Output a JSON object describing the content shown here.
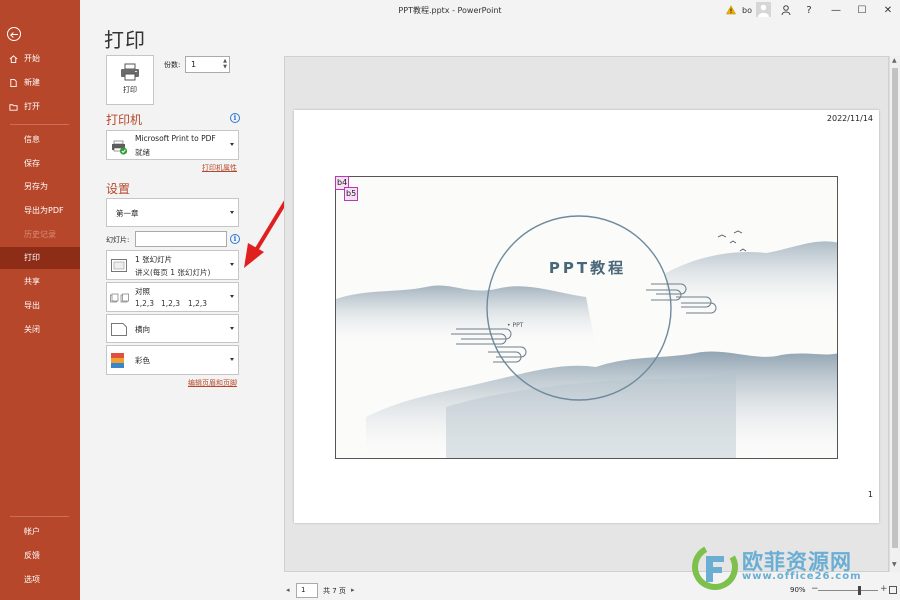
{
  "window": {
    "title": "PPT教程.pptx  -  PowerPoint",
    "user": "bo",
    "help_label": "?",
    "minimize_glyph": "—",
    "maximize_glyph": "☐",
    "close_glyph": "✕"
  },
  "nav": {
    "items": [
      {
        "label": "开始",
        "icon": "home-icon"
      },
      {
        "label": "新建",
        "icon": "new-doc-icon"
      },
      {
        "label": "打开",
        "icon": "folder-icon"
      },
      {
        "label": "信息"
      },
      {
        "label": "保存"
      },
      {
        "label": "另存为"
      },
      {
        "label": "导出为PDF"
      },
      {
        "label": "历史记录"
      },
      {
        "label": "打印"
      },
      {
        "label": "共享"
      },
      {
        "label": "导出"
      },
      {
        "label": "关闭"
      },
      {
        "label": "帐户"
      },
      {
        "label": "反馈"
      },
      {
        "label": "选项"
      }
    ],
    "active": "打印",
    "disabled": "历史记录"
  },
  "print": {
    "page_title": "打印",
    "print_button_label": "打印",
    "copies_label": "份数:",
    "copies_value": "1",
    "printer_heading": "打印机",
    "printer_name": "Microsoft Print to PDF",
    "printer_status": "就绪",
    "printer_properties_link": "打印机属性",
    "settings_heading": "设置",
    "range_value": "第一章",
    "slides_label": "幻灯片:",
    "slides_value": "",
    "layout_line1": "1 张幻灯片",
    "layout_line2": "讲义(每页 1 张幻灯片)",
    "collate_label": "对照",
    "collate_seq": [
      "1,2,3",
      "1,2,3",
      "1,2,3"
    ],
    "orientation_value": "横向",
    "color_value": "彩色",
    "edit_header_footer_link": "编辑页眉和页脚"
  },
  "preview": {
    "date": "2022/11/14",
    "page_number": "1",
    "slide_title": "PPT教程",
    "slide_subtitle": "• PPT",
    "tags": [
      "b4",
      "b5"
    ]
  },
  "pager": {
    "prev_glyph": "◂",
    "next_glyph": "▸",
    "current_page": "1",
    "total_label": "共 7 页",
    "zoom": "90%",
    "zoom_minus": "−",
    "zoom_plus": "+"
  },
  "watermark": {
    "brand_cn": "欧菲资源网",
    "url": "www.office26.com"
  },
  "colors": {
    "accent": "#b7472a",
    "nav_active": "#8d2c17",
    "watermark": "#6aaed3"
  }
}
